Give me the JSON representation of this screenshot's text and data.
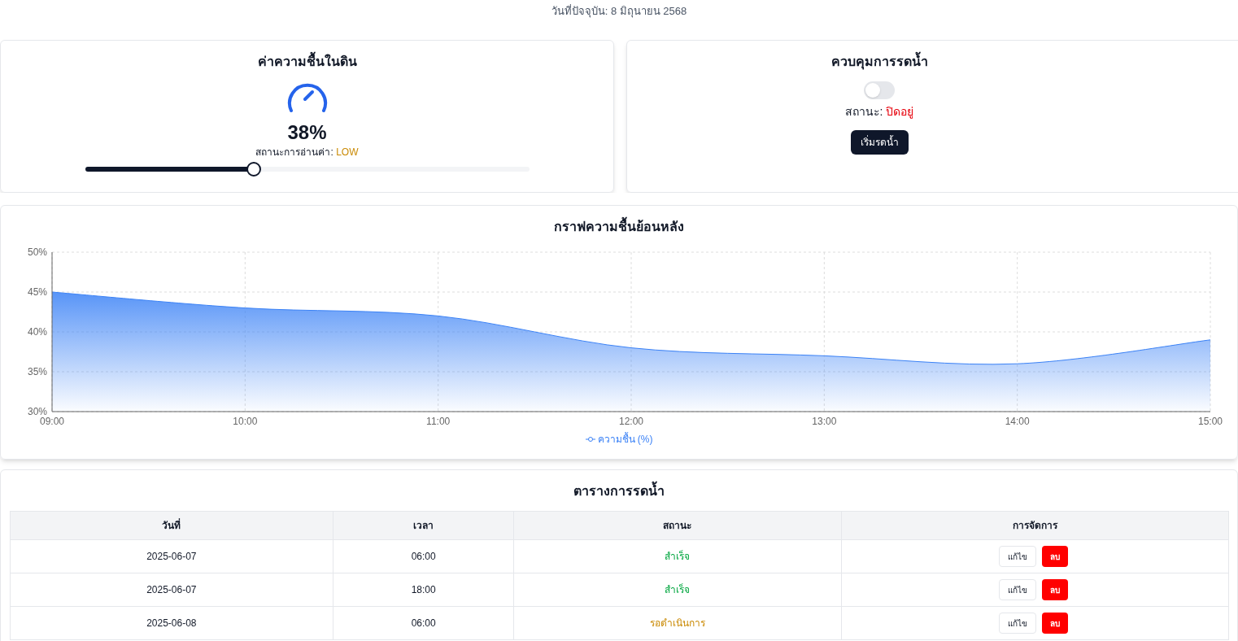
{
  "current_date": "วันที่ปัจจุบัน: 8 มิถุนายน 2568",
  "moisture_card": {
    "title": "ค่าความชื้นในดิน",
    "value": "38%",
    "reading_label": "สถานะการอ่านค่า:",
    "reading_status": "LOW",
    "level": 0.38
  },
  "watering_control": {
    "title": "ควบคุมการรดน้ำ",
    "on": false,
    "status_label": "สถานะ:",
    "status_value": "ปิดอยู่",
    "button": "เริ่มรดน้ำ"
  },
  "history_chart": {
    "title": "กราฟความชื้นย้อนหลัง",
    "chart_data": {
      "type": "area",
      "grid": true,
      "categories": [
        "09:00",
        "10:00",
        "11:00",
        "12:00",
        "13:00",
        "14:00",
        "15:00"
      ],
      "series": [
        {
          "name": "ความชื้น (%)",
          "color": "#3b82f6",
          "values": [
            45,
            43,
            42,
            38,
            37,
            36,
            39
          ]
        }
      ],
      "ylim": [
        30,
        50
      ],
      "yticks": [
        {
          "value": 30,
          "label": "30%"
        },
        {
          "value": 35,
          "label": "35%"
        },
        {
          "value": 40,
          "label": "40%"
        },
        {
          "value": 45,
          "label": "45%"
        },
        {
          "value": 50,
          "label": "50%"
        }
      ]
    }
  },
  "schedule_table": {
    "title": "ตารางการรดน้ำ",
    "columns": [
      "วันที่",
      "เวลา",
      "สถานะ",
      "การจัดการ"
    ],
    "rows": [
      {
        "date": "2025-06-07",
        "time": "06:00",
        "status": "สำเร็จ",
        "kind": "done",
        "edit": "แก้ไข",
        "delete": "ลบ"
      },
      {
        "date": "2025-06-07",
        "time": "18:00",
        "status": "สำเร็จ",
        "kind": "done",
        "edit": "แก้ไข",
        "delete": "ลบ"
      },
      {
        "date": "2025-06-08",
        "time": "06:00",
        "status": "รอดำเนินการ",
        "kind": "pending",
        "edit": "แก้ไข",
        "delete": "ลบ"
      }
    ]
  }
}
